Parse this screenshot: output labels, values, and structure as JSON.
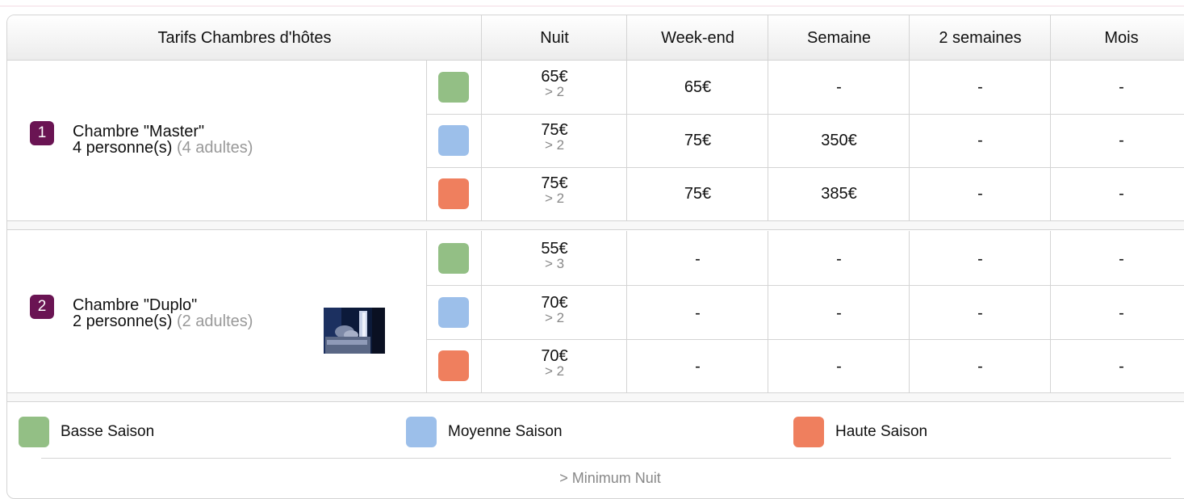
{
  "table": {
    "header": {
      "title": "Tarifs Chambres d'hôtes",
      "columns": [
        "Nuit",
        "Week-end",
        "Semaine",
        "2 semaines",
        "Mois"
      ]
    },
    "rooms": [
      {
        "number": "1",
        "name": "Chambre \"Master\"",
        "capacity": "4 personne(s)",
        "capacity_detail": "(4 adultes)",
        "rates": [
          {
            "season": "basse",
            "nuit": "65€",
            "min": "> 2",
            "weekend": "65€",
            "semaine": "-",
            "deux_semaines": "-",
            "mois": "-"
          },
          {
            "season": "moyenne",
            "nuit": "75€",
            "min": "> 2",
            "weekend": "75€",
            "semaine": "350€",
            "deux_semaines": "-",
            "mois": "-"
          },
          {
            "season": "haute",
            "nuit": "75€",
            "min": "> 2",
            "weekend": "75€",
            "semaine": "385€",
            "deux_semaines": "-",
            "mois": "-"
          }
        ]
      },
      {
        "number": "2",
        "name": "Chambre \"Duplo\"",
        "capacity": "2 personne(s)",
        "capacity_detail": "(2 adultes)",
        "rates": [
          {
            "season": "basse",
            "nuit": "55€",
            "min": "> 3",
            "weekend": "-",
            "semaine": "-",
            "deux_semaines": "-",
            "mois": "-"
          },
          {
            "season": "moyenne",
            "nuit": "70€",
            "min": "> 2",
            "weekend": "-",
            "semaine": "-",
            "deux_semaines": "-",
            "mois": "-"
          },
          {
            "season": "haute",
            "nuit": "70€",
            "min": "> 2",
            "weekend": "-",
            "semaine": "-",
            "deux_semaines": "-",
            "mois": "-"
          }
        ]
      }
    ]
  },
  "legend": {
    "items": [
      {
        "label": "Basse Saison",
        "color": "#93bf85"
      },
      {
        "label": "Moyenne Saison",
        "color": "#9cbfea"
      },
      {
        "label": "Haute Saison",
        "color": "#ef7f5e"
      }
    ],
    "min_note": "> Minimum Nuit"
  },
  "colors": {
    "badge": "#6a1453",
    "basse": "#93bf85",
    "moyenne": "#9cbfea",
    "haute": "#ef7f5e"
  }
}
